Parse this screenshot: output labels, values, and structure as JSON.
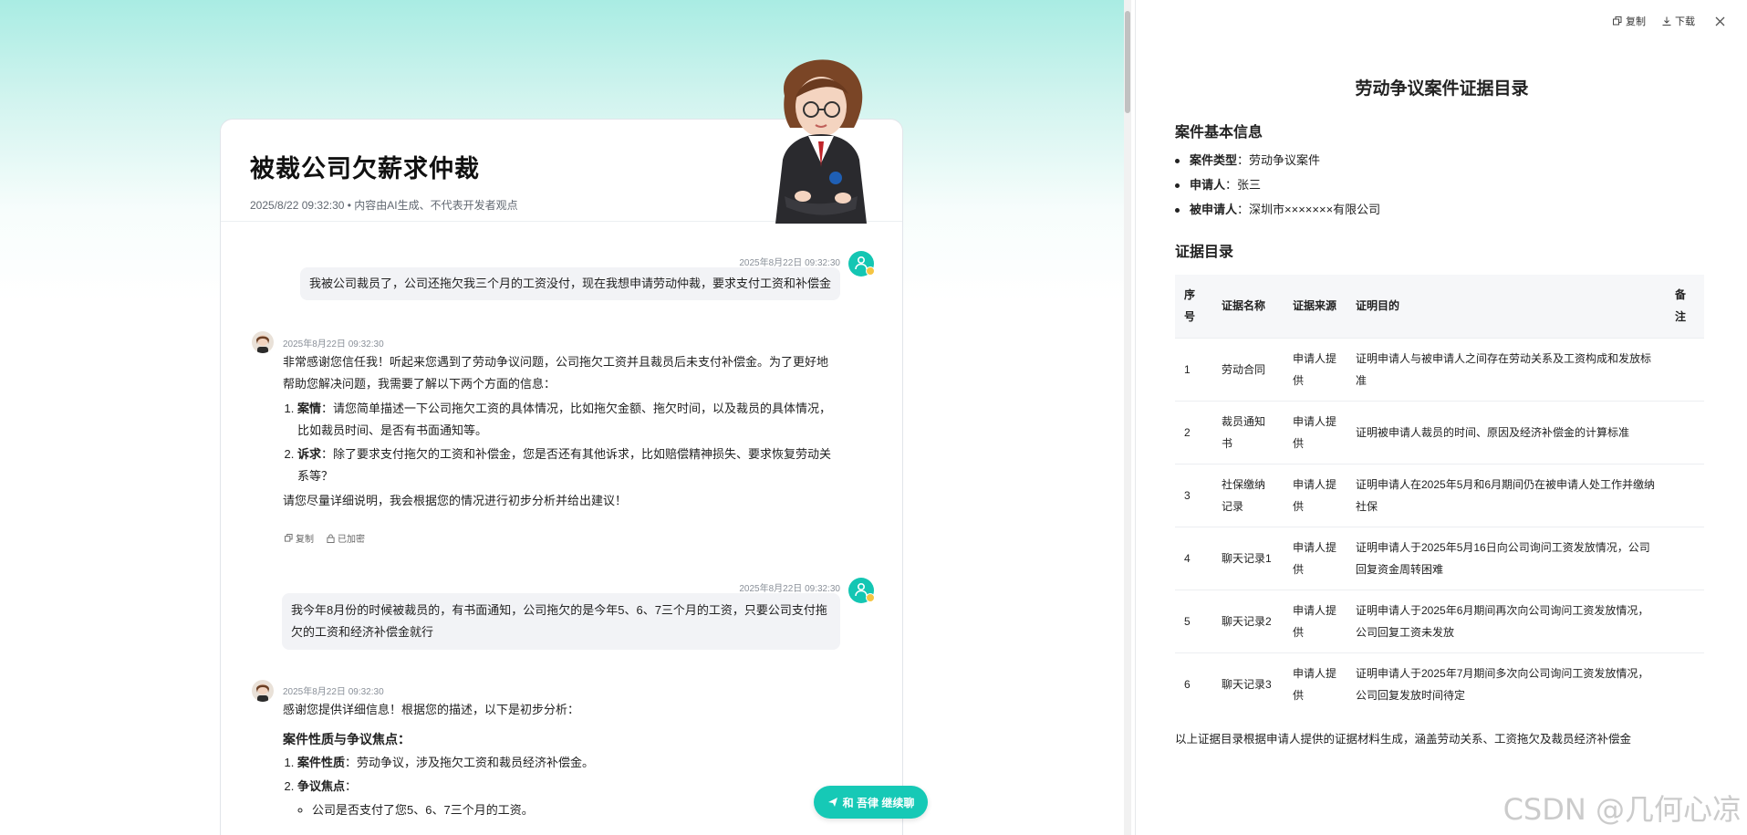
{
  "chat": {
    "title": "被裁公司欠薪求仲裁",
    "meta": "2025/8/22 09:32:30 • 内容由AI生成、不代表开发者观点",
    "messages": [
      {
        "time": "2025年8月22日 09:32:30",
        "text": "我被公司裁员了，公司还拖欠我三个月的工资没付，现在我想申请劳动仲裁，要求支付工资和补偿金"
      },
      {
        "time": "2025年8月22日 09:32:30",
        "intro": "非常感谢您信任我！听起来您遇到了劳动争议问题，公司拖欠工资并且裁员后未支付补偿金。为了更好地帮助您解决问题，我需要了解以下两个方面的信息：",
        "items": [
          {
            "label": "案情",
            "text": "：请您简单描述一下公司拖欠工资的具体情况，比如拖欠金额、拖欠时间，以及裁员的具体情况，比如裁员时间、是否有书面通知等。"
          },
          {
            "label": "诉求",
            "text": "：除了要求支付拖欠的工资和补偿金，您是否还有其他诉求，比如赔偿精神损失、要求恢复劳动关系等？"
          }
        ],
        "outro": "请您尽量详细说明，我会根据您的情况进行初步分析并给出建议！",
        "copy_label": "复制",
        "encrypt_label": "已加密"
      },
      {
        "time": "2025年8月22日 09:32:30",
        "text": "我今年8月份的时候被裁员的，有书面通知，公司拖欠的是今年5、6、7三个月的工资，只要公司支付拖欠的工资和经济补偿金就行"
      },
      {
        "time": "2025年8月22日 09:32:30",
        "intro": "感谢您提供详细信息！根据您的描述，以下是初步分析：",
        "heading": "案件性质与争议焦点：",
        "items": [
          {
            "label": "案件性质",
            "text": "：劳动争议，涉及拖欠工资和裁员经济补偿金。"
          },
          {
            "label": "争议焦点",
            "text": "："
          }
        ],
        "sub": "公司是否支付了您5、6、7三个月的工资。"
      }
    ],
    "continue_label": "和 吾律 继续聊"
  },
  "doc": {
    "copy_label": "复制",
    "download_label": "下载",
    "title": "劳动争议案件证据目录",
    "section1": "案件基本信息",
    "info": [
      {
        "k": "案件类型",
        "v": "：劳动争议案件"
      },
      {
        "k": "申请人",
        "v": "：张三"
      },
      {
        "k": "被申请人",
        "v": "：深圳市×××××××有限公司"
      }
    ],
    "section2": "证据目录",
    "table": {
      "headers": [
        "序号",
        "证据名称",
        "证据来源",
        "证明目的",
        "备注"
      ],
      "rows": [
        [
          "1",
          "劳动合同",
          "申请人提供",
          "证明申请人与被申请人之间存在劳动关系及工资构成和发放标准",
          ""
        ],
        [
          "2",
          "裁员通知书",
          "申请人提供",
          "证明被申请人裁员的时间、原因及经济补偿金的计算标准",
          ""
        ],
        [
          "3",
          "社保缴纳记录",
          "申请人提供",
          "证明申请人在2025年5月和6月期间仍在被申请人处工作并缴纳社保",
          ""
        ],
        [
          "4",
          "聊天记录1",
          "申请人提供",
          "证明申请人于2025年5月16日向公司询问工资发放情况，公司回复资金周转困难",
          ""
        ],
        [
          "5",
          "聊天记录2",
          "申请人提供",
          "证明申请人于2025年6月期间再次向公司询问工资发放情况，公司回复工资未发放",
          ""
        ],
        [
          "6",
          "聊天记录3",
          "申请人提供",
          "证明申请人于2025年7月期间多次向公司询问工资发放情况，公司回复发放时间待定",
          ""
        ]
      ]
    },
    "footnote": "以上证据目录根据申请人提供的证据材料生成，涵盖劳动关系、工资拖欠及裁员经济补偿金"
  },
  "watermark": "CSDN @几何心凉"
}
